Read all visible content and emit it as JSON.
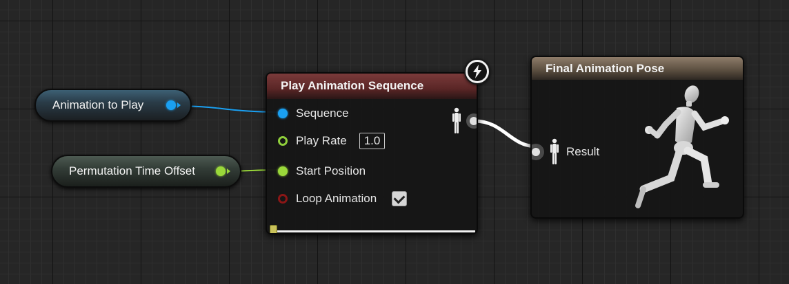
{
  "variables": {
    "animation_to_play": {
      "label": "Animation to Play",
      "pin_color": "#1aa0f2"
    },
    "permutation_time_offset": {
      "label": "Permutation Time Offset",
      "pin_color": "#9ad83a"
    }
  },
  "play_node": {
    "title": "Play Animation Sequence",
    "header_color": "#7a3a3a",
    "badge_icon": "lightning-bolt-icon",
    "pins": {
      "sequence": {
        "label": "Sequence"
      },
      "play_rate": {
        "label": "Play Rate",
        "value": "1.0"
      },
      "start_position": {
        "label": "Start Position"
      },
      "loop_animation": {
        "label": "Loop Animation",
        "checked": true
      }
    },
    "output_pin_icon": "pose-figure-icon",
    "slider_value": 0
  },
  "result_node": {
    "title": "Final Animation Pose",
    "header_color": "#8e7c6a",
    "result_label": "Result",
    "preview_icon": "running-mannequin-icon"
  },
  "colors": {
    "background": "#262626",
    "wire_object": "#1aa0f2",
    "wire_float": "#9ad83a",
    "wire_pose": "#ffffff"
  }
}
